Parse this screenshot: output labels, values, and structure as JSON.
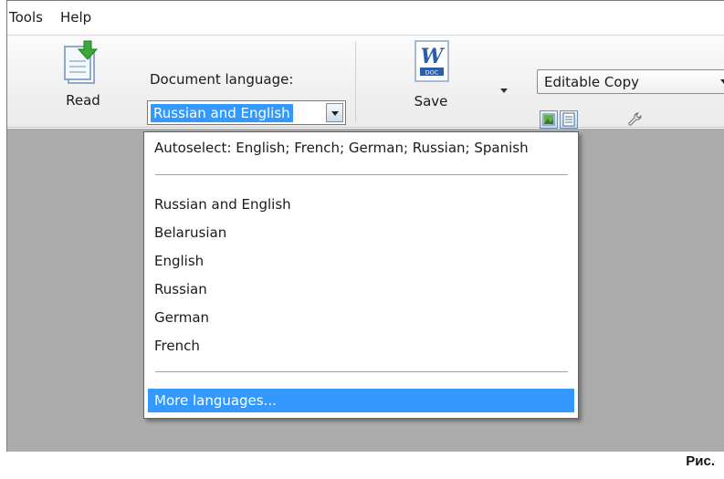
{
  "menubar": {
    "items": [
      "Tools",
      "Help"
    ]
  },
  "ribbon": {
    "read_label": "Read",
    "document_language_label": "Document language:",
    "document_language_value": "Russian and English",
    "save_label": "Save",
    "save_icon_text": "W",
    "save_icon_badge": "DOC",
    "copy_mode_value": "Editable Copy"
  },
  "language_dropdown": {
    "autoselect": "Autoselect: English; French; German; Russian; Spanish",
    "languages": [
      "Russian and English",
      "Belarusian",
      "English",
      "Russian",
      "German",
      "French"
    ],
    "more": "More languages..."
  },
  "caption": "Рис.",
  "colors": {
    "selection": "#3399ff",
    "workspace": "#ababab"
  }
}
